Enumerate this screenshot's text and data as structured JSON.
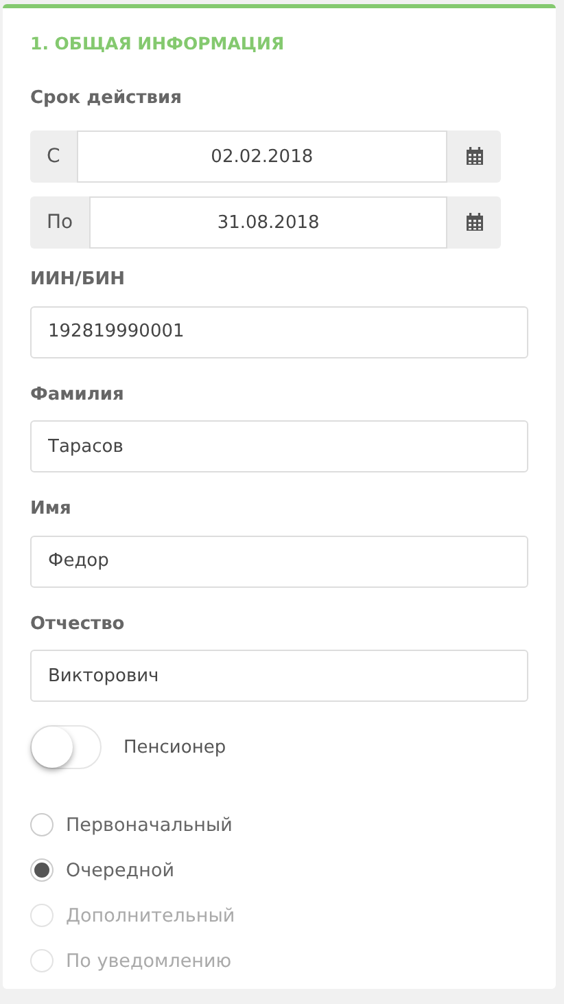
{
  "section": {
    "title": "1. ОБЩАЯ ИНФОРМАЦИЯ"
  },
  "validity": {
    "label": "Срок действия",
    "ranges": [
      {
        "prefix": "С",
        "value": "02.02.2018"
      },
      {
        "prefix": "По",
        "value": "31.08.2018"
      }
    ]
  },
  "fields": [
    {
      "label": "ИИН/БИН",
      "value": "192819990001"
    },
    {
      "label": "Фамилия",
      "value": "Тарасов"
    },
    {
      "label": "Имя",
      "value": "Федор"
    },
    {
      "label": "Отчество",
      "value": "Викторович"
    }
  ],
  "pensioner": {
    "label": "Пенсионер",
    "on": false
  },
  "options": [
    {
      "label": "Первоначальный",
      "selected": false,
      "disabled": false
    },
    {
      "label": "Очередной",
      "selected": true,
      "disabled": false
    },
    {
      "label": "Дополнительный",
      "selected": false,
      "disabled": true
    },
    {
      "label": "По уведомлению",
      "selected": false,
      "disabled": true
    }
  ]
}
